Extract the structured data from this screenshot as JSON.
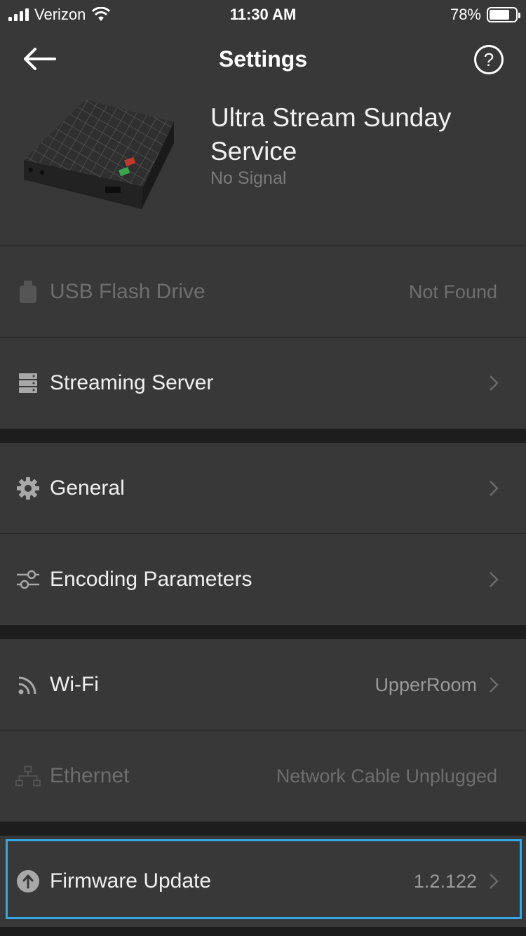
{
  "status_bar": {
    "carrier": "Verizon",
    "time": "11:30 AM",
    "battery_percent": "78%",
    "battery_level": 0.78
  },
  "header": {
    "title": "Settings",
    "help_glyph": "?",
    "device_name": "Ultra Stream Sunday Service",
    "device_status": "No Signal"
  },
  "rows": {
    "usb": {
      "icon": "usb-drive-icon",
      "label": "USB Flash Drive",
      "value": "Not Found"
    },
    "streaming": {
      "icon": "server-icon",
      "label": "Streaming Server"
    },
    "general": {
      "icon": "gear-icon",
      "label": "General"
    },
    "encoding": {
      "icon": "sliders-icon",
      "label": "Encoding Parameters"
    },
    "wifi": {
      "icon": "wifi-icon",
      "label": "Wi-Fi",
      "value": "UpperRoom"
    },
    "ethernet": {
      "icon": "ethernet-icon",
      "label": "Ethernet",
      "value": "Network Cable Unplugged"
    },
    "firmware": {
      "icon": "upload-icon",
      "label": "Firmware Update",
      "value": "1.2.122"
    }
  },
  "colors": {
    "background": "#1d1d1d",
    "row": "#383838",
    "accent_focus": "#34a8e2"
  }
}
